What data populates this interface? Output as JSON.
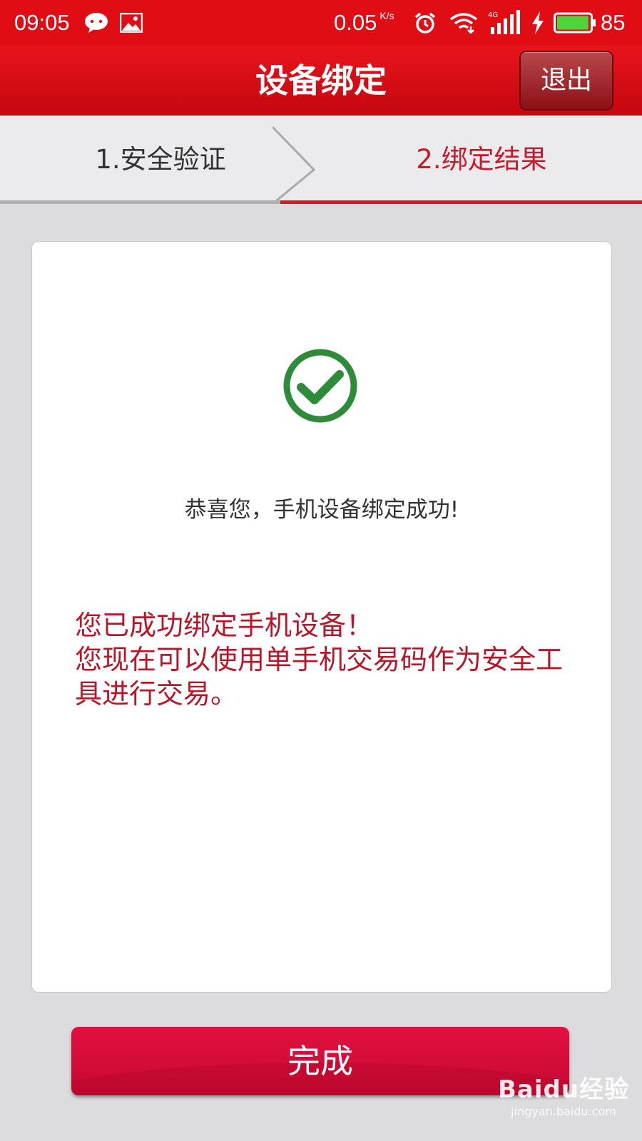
{
  "status_bar": {
    "time": "09:05",
    "speed": "0.05",
    "speed_unit": "K/s",
    "battery_percent": "85",
    "battery_level": 0.85
  },
  "header": {
    "title": "设备绑定",
    "exit_label": "退出"
  },
  "steps": [
    {
      "label": "1.安全验证",
      "active": false
    },
    {
      "label": "2.绑定结果",
      "active": true
    }
  ],
  "result": {
    "success_message": "恭喜您，手机设备绑定成功!",
    "info_message": "您已成功绑定手机设备！\n您现在可以使用单手机交易码作为安全工具进行交易。"
  },
  "actions": {
    "done_label": "完成"
  },
  "watermark": {
    "brand": "Baidu经验",
    "url": "jingyan.baidu.com"
  },
  "colors": {
    "status_bar": "#e00d14",
    "header": "#d40c13",
    "active_step": "#c71a2a",
    "success_green": "#2e8b3a",
    "info_text": "#b8172a",
    "done_button": "#d60c38"
  }
}
